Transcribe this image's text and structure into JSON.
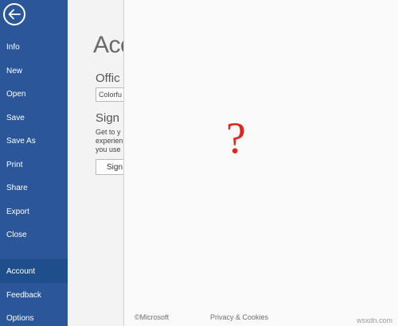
{
  "nav": {
    "back_icon": "back-arrow-icon",
    "items": [
      {
        "label": "Info"
      },
      {
        "label": "New"
      },
      {
        "label": "Open"
      },
      {
        "label": "Save"
      },
      {
        "label": "Save As"
      },
      {
        "label": "Print"
      },
      {
        "label": "Share"
      },
      {
        "label": "Export"
      },
      {
        "label": "Close"
      },
      {
        "label": "Account",
        "selected": true
      },
      {
        "label": "Feedback"
      },
      {
        "label": "Options"
      }
    ],
    "color": "#2b579a",
    "selected_color": "#1e4e8c"
  },
  "account": {
    "title": "Acc",
    "office_theme_heading": "Offic",
    "theme_value": "Colorfu",
    "sign_in_heading": "Sign",
    "sign_in_description_lines": [
      "Get to y",
      "experien",
      "you use"
    ],
    "sign_in_button": "Sign"
  },
  "dialog": {
    "placeholder_glyph": "?",
    "placeholder_color": "#e0261b",
    "footer_copyright": "©Microsoft",
    "footer_privacy": "Privacy & Cookies"
  },
  "watermark": "wsxdn.com"
}
